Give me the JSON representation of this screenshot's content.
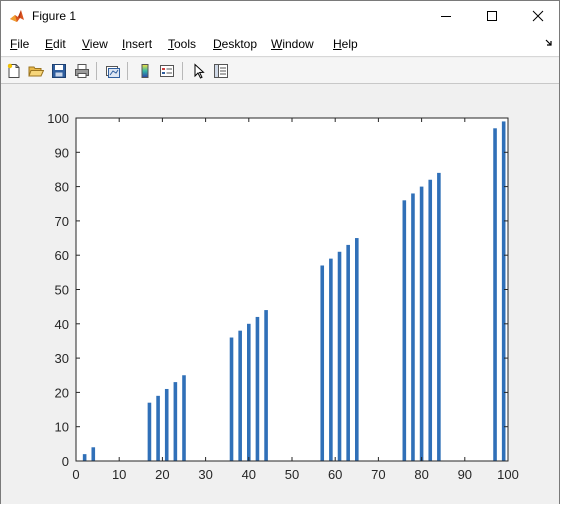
{
  "window": {
    "title": "Figure 1",
    "controls": [
      "minimize-icon",
      "maximize-icon",
      "close-icon"
    ]
  },
  "menu": {
    "items": [
      {
        "label": "File"
      },
      {
        "label": "Edit"
      },
      {
        "label": "View"
      },
      {
        "label": "Insert"
      },
      {
        "label": "Tools"
      },
      {
        "label": "Desktop"
      },
      {
        "label": "Window"
      },
      {
        "label": "Help"
      }
    ]
  },
  "toolbar": {
    "tools": [
      "new-figure-icon",
      "open-file-icon",
      "save-icon",
      "print-icon",
      "link-plot-icon",
      "insert-colorbar-icon",
      "insert-legend-icon",
      "edit-plot-icon",
      "property-inspector-icon"
    ]
  },
  "colors": {
    "bar": "#3070b8",
    "axes_bg": "#ffffff",
    "figure_bg": "#f0f0f0"
  },
  "chart_data": {
    "type": "bar",
    "title": "",
    "xlabel": "",
    "ylabel": "",
    "xlim": [
      0,
      100
    ],
    "ylim": [
      0,
      100
    ],
    "xticks": [
      0,
      10,
      20,
      30,
      40,
      50,
      60,
      70,
      80,
      90,
      100
    ],
    "yticks": [
      0,
      10,
      20,
      30,
      40,
      50,
      60,
      70,
      80,
      90,
      100
    ],
    "grid": false,
    "x": [
      2,
      4,
      17,
      19,
      21,
      23,
      25,
      36,
      38,
      40,
      42,
      44,
      57,
      59,
      61,
      63,
      65,
      76,
      78,
      80,
      82,
      84,
      97,
      99
    ],
    "values": [
      2,
      4,
      17,
      19,
      21,
      23,
      25,
      36,
      38,
      40,
      42,
      44,
      57,
      59,
      61,
      63,
      65,
      76,
      78,
      80,
      82,
      84,
      97,
      99
    ]
  }
}
